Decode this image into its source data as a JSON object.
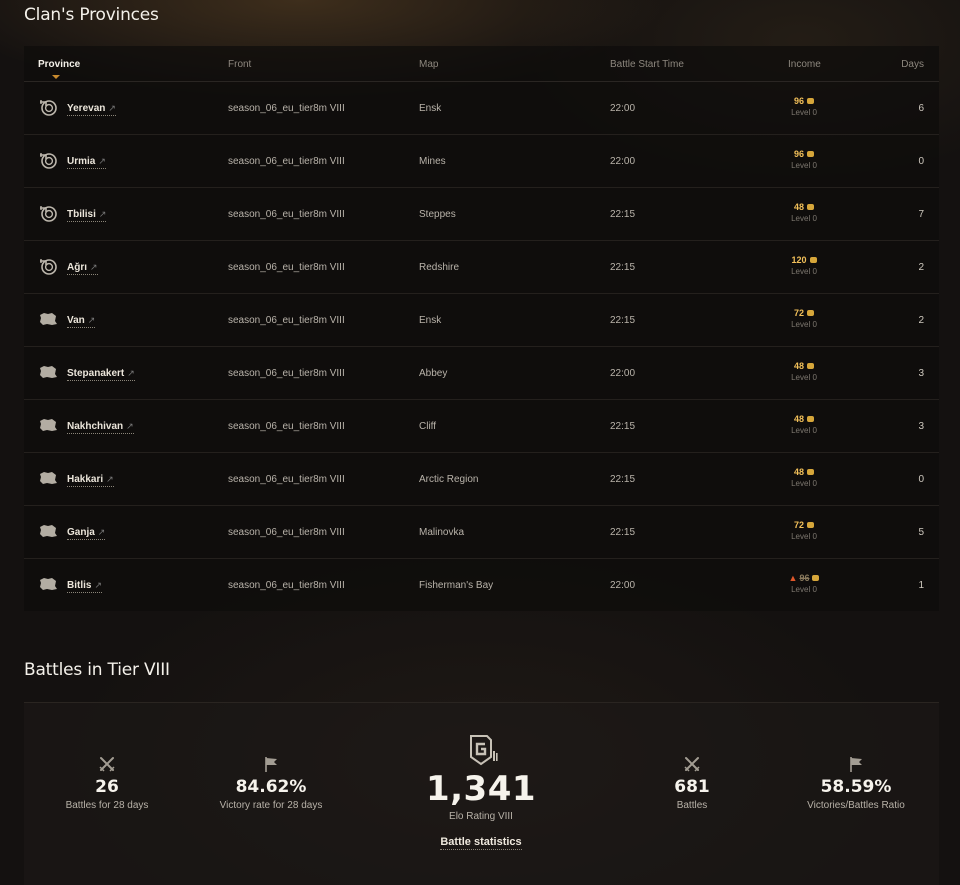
{
  "provinces_title": "Clan's Provinces",
  "columns": {
    "province": "Province",
    "front": "Front",
    "map": "Map",
    "battle_start_time": "Battle Start Time",
    "income": "Income",
    "days": "Days"
  },
  "rows": [
    {
      "icon": "target-icon",
      "name": "Yerevan",
      "front": "season_06_eu_tier8m VIII",
      "map": "Ensk",
      "time": "22:00",
      "income": "96",
      "level": "Level 0",
      "days": "6"
    },
    {
      "icon": "target-icon",
      "name": "Urmia",
      "front": "season_06_eu_tier8m VIII",
      "map": "Mines",
      "time": "22:00",
      "income": "96",
      "level": "Level 0",
      "days": "0"
    },
    {
      "icon": "target-icon",
      "name": "Tbilisi",
      "front": "season_06_eu_tier8m VIII",
      "map": "Steppes",
      "time": "22:15",
      "income": "48",
      "level": "Level 0",
      "days": "7"
    },
    {
      "icon": "target-icon",
      "name": "Ağrı",
      "front": "season_06_eu_tier8m VIII",
      "map": "Redshire",
      "time": "22:15",
      "income": "120",
      "level": "Level 0",
      "days": "2"
    },
    {
      "icon": "territory-icon",
      "name": "Van",
      "front": "season_06_eu_tier8m VIII",
      "map": "Ensk",
      "time": "22:15",
      "income": "72",
      "level": "Level 0",
      "days": "2"
    },
    {
      "icon": "territory-icon",
      "name": "Stepanakert",
      "front": "season_06_eu_tier8m VIII",
      "map": "Abbey",
      "time": "22:00",
      "income": "48",
      "level": "Level 0",
      "days": "3"
    },
    {
      "icon": "territory-icon",
      "name": "Nakhchivan",
      "front": "season_06_eu_tier8m VIII",
      "map": "Cliff",
      "time": "22:15",
      "income": "48",
      "level": "Level 0",
      "days": "3"
    },
    {
      "icon": "territory-icon",
      "name": "Hakkari",
      "front": "season_06_eu_tier8m VIII",
      "map": "Arctic Region",
      "time": "22:15",
      "income": "48",
      "level": "Level 0",
      "days": "0"
    },
    {
      "icon": "territory-icon",
      "name": "Ganja",
      "front": "season_06_eu_tier8m VIII",
      "map": "Malinovka",
      "time": "22:15",
      "income": "72",
      "level": "Level 0",
      "days": "5"
    },
    {
      "icon": "territory-icon",
      "name": "Bitlis",
      "front": "season_06_eu_tier8m VIII",
      "map": "Fisherman's Bay",
      "time": "22:00",
      "income": "96",
      "income_struck": true,
      "level": "Level 0",
      "days": "1"
    }
  ],
  "battles_title": "Battles in Tier VIII",
  "stats": {
    "battles_28": {
      "value": "26",
      "label": "Battles for 28 days",
      "icon": "crossed-swords-icon"
    },
    "victory_28": {
      "value": "84.62%",
      "label": "Victory rate for 28 days",
      "icon": "flag-icon"
    },
    "elo": {
      "value": "1,341",
      "label": "Elo Rating VIII",
      "icon": "global-map-logo-icon"
    },
    "battles": {
      "value": "681",
      "label": "Battles",
      "icon": "crossed-swords-icon"
    },
    "ratio": {
      "value": "58.59%",
      "label": "Victories/Battles Ratio",
      "icon": "flag-icon"
    }
  },
  "battle_statistics_link": "Battle statistics",
  "colors": {
    "accent": "#c88a2e",
    "gold": "#f2c05a",
    "fire": "#e0572a"
  }
}
